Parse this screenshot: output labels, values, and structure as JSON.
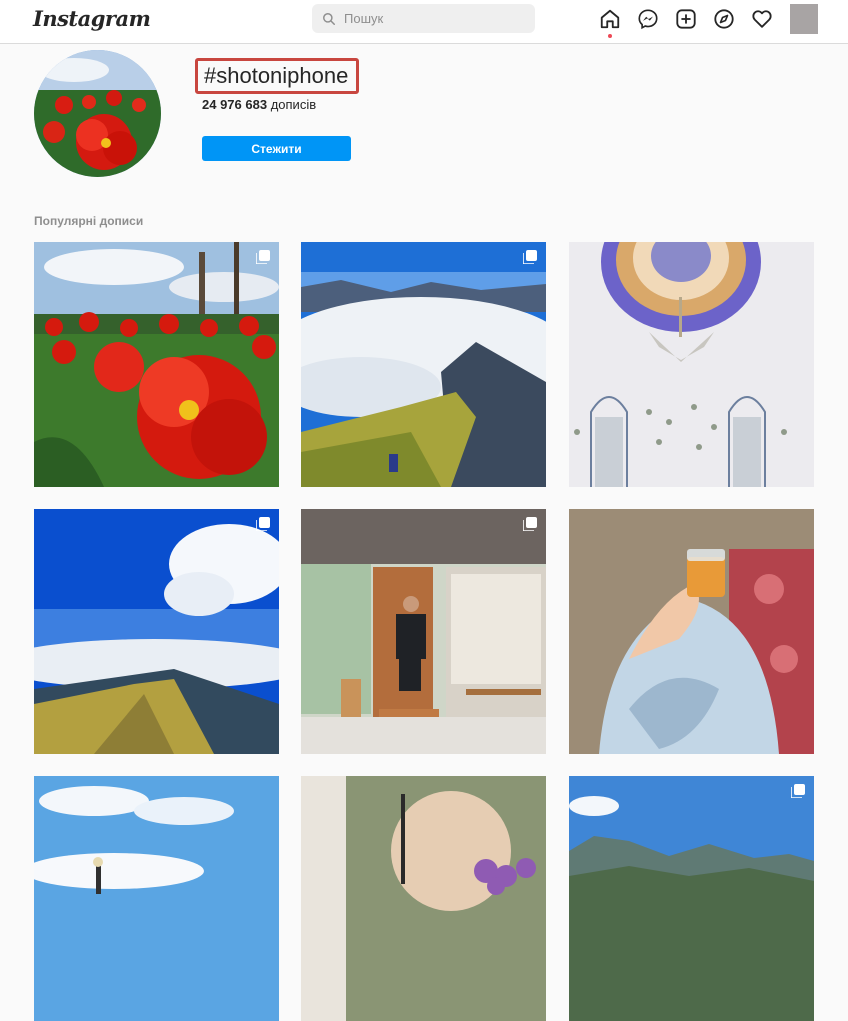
{
  "nav": {
    "logo": "Instagram",
    "search_placeholder": "Пошук",
    "icons": [
      "home-icon",
      "messenger-icon",
      "new-post-icon",
      "explore-icon",
      "activity-icon"
    ]
  },
  "header": {
    "hashtag": "#shotoniphone",
    "post_count": "24 976 683",
    "post_count_suffix": "дописів",
    "follow_label": "Стежити"
  },
  "section": {
    "label": "Популярні дописи"
  },
  "colors": {
    "accent": "#0095f6",
    "highlight_border": "#c8463f"
  },
  "posts": [
    {
      "subject": "red tulips",
      "multi": true
    },
    {
      "subject": "mountain above clouds",
      "multi": true
    },
    {
      "subject": "mosque ceiling",
      "multi": false
    },
    {
      "subject": "blue sky mountain ridge",
      "multi": true
    },
    {
      "subject": "man in front of shop",
      "multi": true
    },
    {
      "subject": "hand holding glass of tea",
      "multi": false
    },
    {
      "subject": "sky with street lamp",
      "multi": false
    },
    {
      "subject": "flowers and round mirror",
      "multi": false
    },
    {
      "subject": "blue sky mountain range",
      "multi": true
    }
  ]
}
